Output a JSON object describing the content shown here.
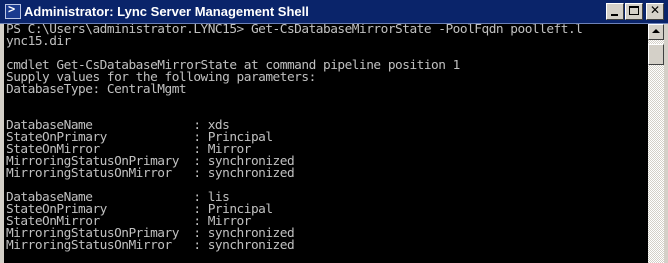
{
  "window": {
    "title": "Administrator: Lync Server Management Shell"
  },
  "console": {
    "lines": [
      "PS C:\\Users\\administrator.LYNC15> Get-CsDatabaseMirrorState -PoolFqdn poolleft.l",
      "ync15.dir",
      "",
      "cmdlet Get-CsDatabaseMirrorState at command pipeline position 1",
      "Supply values for the following parameters:",
      "DatabaseType: CentralMgmt",
      "",
      "",
      "DatabaseName              : xds",
      "StateOnPrimary            : Principal",
      "StateOnMirror             : Mirror",
      "MirroringStatusOnPrimary  : synchronized",
      "MirroringStatusOnMirror   : synchronized",
      "",
      "DatabaseName              : lis",
      "StateOnPrimary            : Principal",
      "StateOnMirror             : Mirror",
      "MirroringStatusOnPrimary  : synchronized",
      "MirroringStatusOnMirror   : synchronized"
    ]
  },
  "colors": {
    "titlebar": "#0a246a",
    "console_bg": "#000000",
    "console_fg": "#c0c0c0",
    "chrome": "#d4d0c8"
  },
  "icons": {
    "app": "powershell-icon",
    "minimize": "minimize-icon",
    "maximize": "maximize-icon",
    "close": "close-icon",
    "scroll_up": "scroll-up-arrow-icon"
  }
}
